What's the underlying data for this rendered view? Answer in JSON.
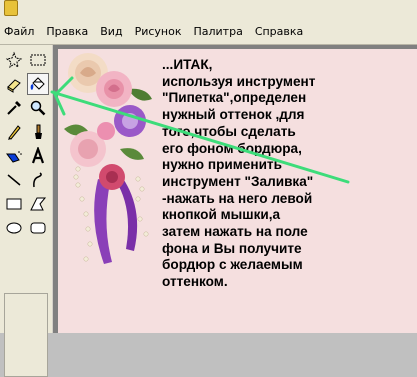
{
  "window": {
    "icon": "paint-app-icon"
  },
  "menu": [
    "Файл",
    "Правка",
    "Вид",
    "Рисунок",
    "Палитра",
    "Справка"
  ],
  "toolbox": {
    "tools": [
      {
        "name": "free-select-icon"
      },
      {
        "name": "rect-select-icon"
      },
      {
        "name": "eraser-icon"
      },
      {
        "name": "fill-bucket-icon",
        "active": true
      },
      {
        "name": "eyedropper-icon"
      },
      {
        "name": "magnifier-icon"
      },
      {
        "name": "pencil-icon"
      },
      {
        "name": "brush-icon"
      },
      {
        "name": "airbrush-icon"
      },
      {
        "name": "text-icon"
      },
      {
        "name": "line-icon"
      },
      {
        "name": "curve-icon"
      },
      {
        "name": "rectangle-icon"
      },
      {
        "name": "polygon-icon"
      },
      {
        "name": "ellipse-icon"
      },
      {
        "name": "rounded-rect-icon"
      }
    ]
  },
  "canvas": {
    "background_color": "#f5dfdf",
    "text": "...ИТАК,\nиспользуя инструмент\n\"Пипетка\",определен\nнужный оттенок ,для\nтого,чтобы сделать\nего фоном бордюра,\nнужно применить\nинструмент \"Заливка\"\n-нажать на него левой\nкнопкой мышки,а\nзатем нажать на поле\nфона и Вы получите\nбордюр с желаемым\nоттенком."
  },
  "annotation_color": "#3ddc7a"
}
